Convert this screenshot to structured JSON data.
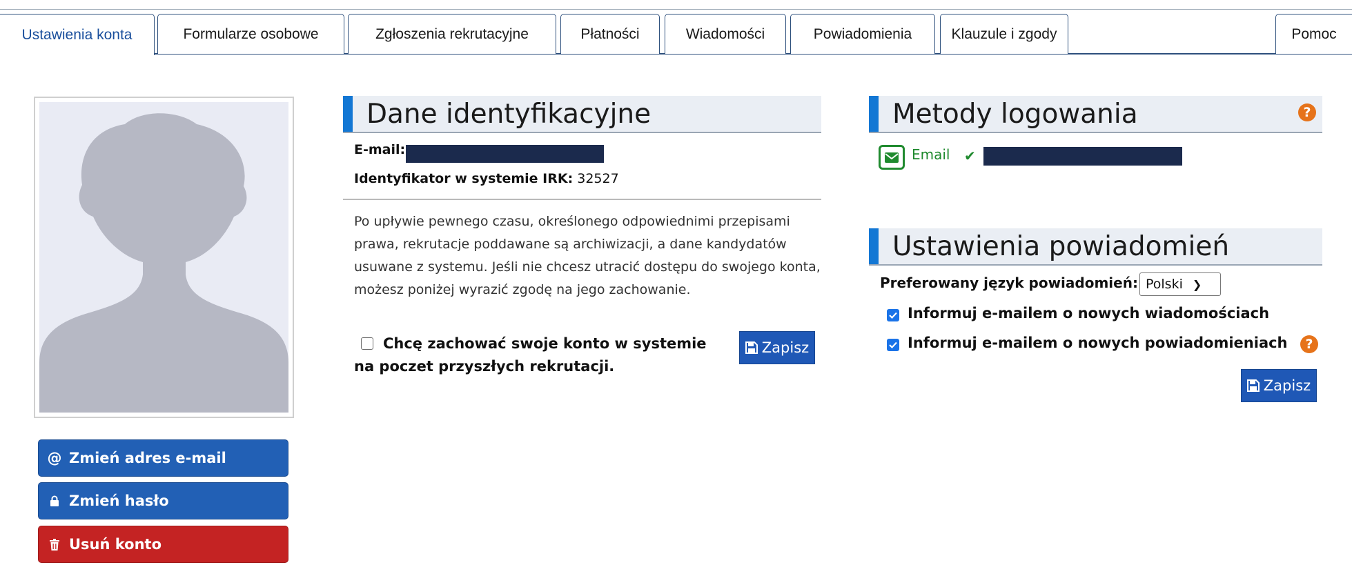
{
  "tabs": [
    {
      "label": "Ustawienia konta",
      "active": true
    },
    {
      "label": "Formularze osobowe"
    },
    {
      "label": "Zgłoszenia rekrutacyjne"
    },
    {
      "label": "Płatności"
    },
    {
      "label": "Wiadomości"
    },
    {
      "label": "Powiadomienia"
    },
    {
      "label": "Klauzule i zgody"
    },
    {
      "label": "Pomoc"
    }
  ],
  "left_actions": {
    "change_email": "Zmień adres e-mail",
    "change_password": "Zmień hasło",
    "delete_account": "Usuń konto"
  },
  "identification": {
    "title": "Dane identyfikacyjne",
    "email_label": "E-mail:",
    "irk_id_label": "Identyfikator w systemie IRK:",
    "irk_id_value": "32527",
    "archive_notice": "Po upływie pewnego czasu, określonego odpowiednimi przepisami prawa, rekrutacje poddawane są archiwizacji, a dane kandydatów usuwane z systemu. Jeśli nie chcesz utracić dostępu do swojego konta, możesz poniżej wyrazić zgodę na jego zachowanie.",
    "keep_account_label": "Chcę zachować swoje konto w systemie na poczet przyszłych rekrutacji.",
    "keep_account_checked": false,
    "save_label": "Zapisz"
  },
  "login_methods": {
    "title": "Metody logowania",
    "email_method_label": "Email"
  },
  "notifications": {
    "title": "Ustawienia powiadomień",
    "language_label": "Preferowany język powiadomień:",
    "language_value": "Polski",
    "notify_messages_label": "Informuj e-mailem o nowych wiadomościach",
    "notify_messages_checked": true,
    "notify_notifications_label": "Informuj e-mailem o nowych powiadomieniach",
    "notify_notifications_checked": true,
    "save_label": "Zapisz"
  },
  "colors": {
    "accent_blue": "#1377d4",
    "button_blue": "#2260b5",
    "danger_red": "#c42323",
    "help_orange": "#e6731a",
    "success_green": "#1f8a2e"
  }
}
